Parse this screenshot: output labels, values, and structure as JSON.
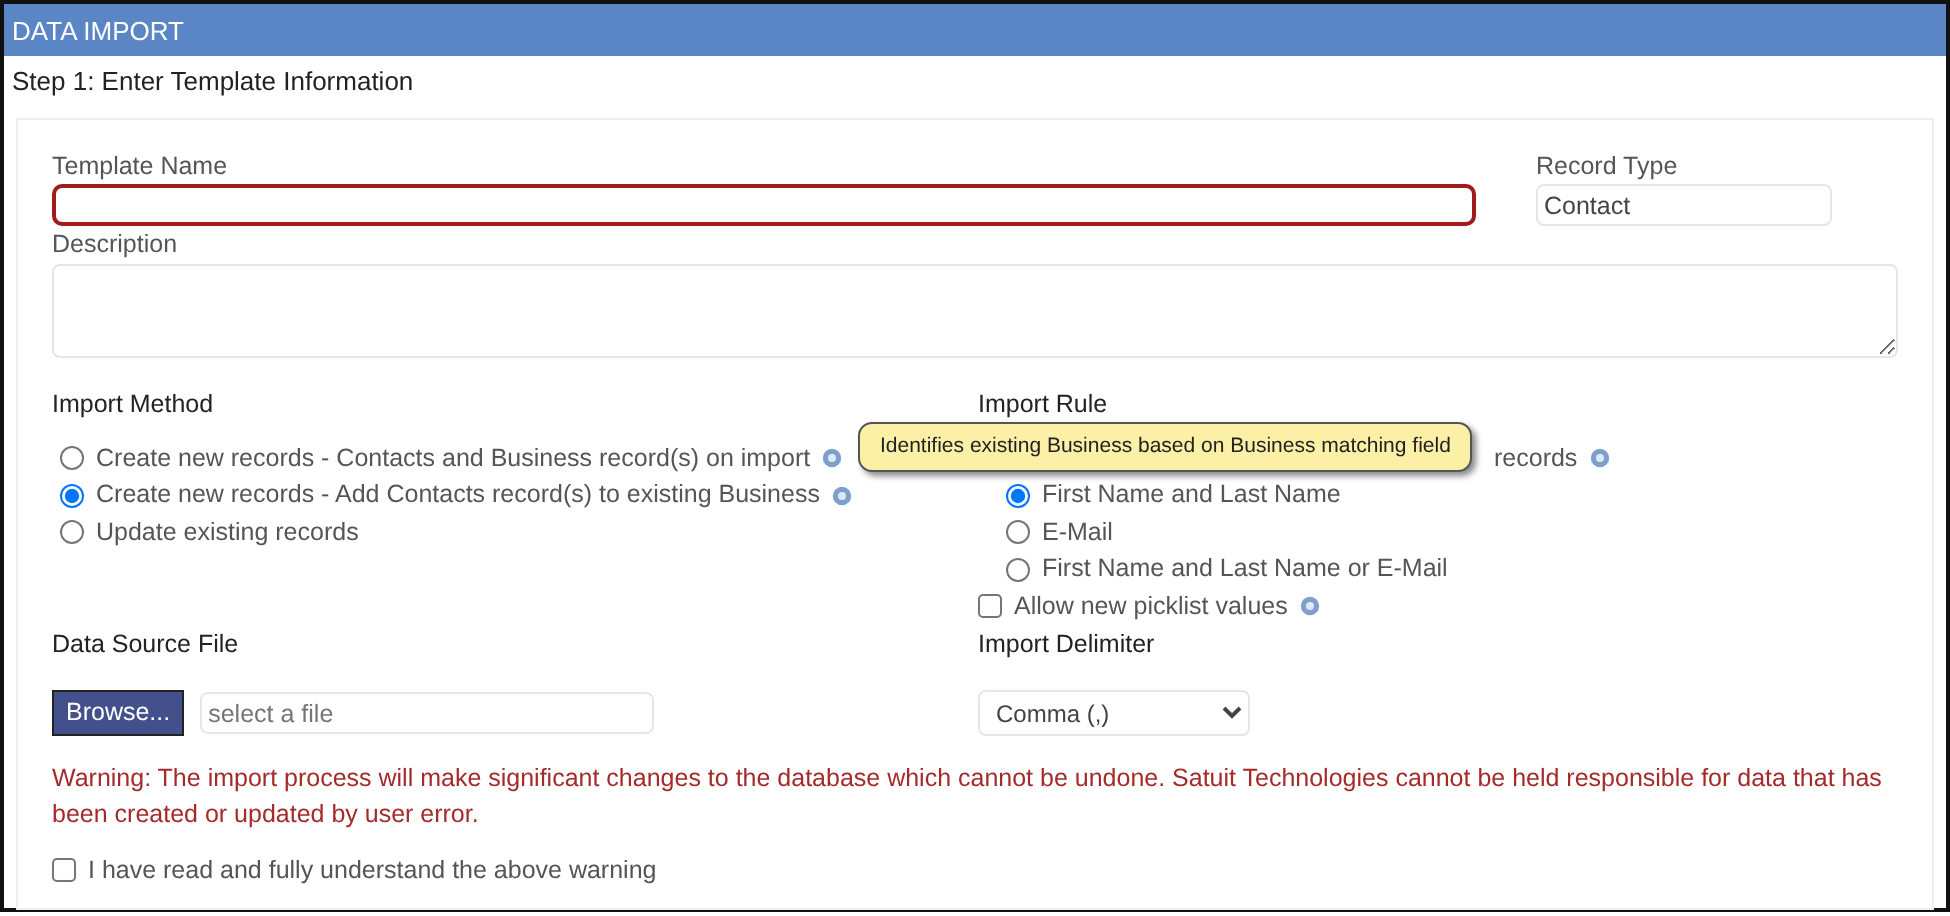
{
  "window": {
    "title": "DATA IMPORT"
  },
  "step": "Step 1: Enter Template Information",
  "template_name": {
    "label": "Template Name",
    "invalid": true
  },
  "record_type": {
    "label": "Record Type",
    "value": "Contact"
  },
  "description": {
    "label": "Description"
  },
  "import_method": {
    "label": "Import Method",
    "options": [
      {
        "label": "Create new records - Contacts and Business record(s) on import",
        "selected": false,
        "help": true
      },
      {
        "label": "Create new records - Add Contacts record(s) to existing Business",
        "selected": true,
        "help": true
      },
      {
        "label": "Update existing records",
        "selected": false,
        "help": false
      }
    ]
  },
  "import_rule": {
    "label": "Import Rule",
    "partial_option": "records",
    "options": [
      {
        "label": "First Name and Last Name",
        "selected": true
      },
      {
        "label": "E-Mail",
        "selected": false
      },
      {
        "label": "First Name and Last Name or E-Mail",
        "selected": false
      }
    ],
    "allow_picklist": {
      "label": "Allow new picklist values",
      "checked": false
    }
  },
  "tooltip": "Identifies existing Business based on Business matching field",
  "data_source": {
    "label": "Data Source File",
    "button": "Browse...",
    "placeholder": "select a file"
  },
  "delimiter": {
    "label": "Import Delimiter",
    "value": "Comma (,)"
  },
  "warning": "Warning: The import process will make significant changes to the database which cannot be undone. Satuit Technologies cannot be held responsible for data that has been created or updated by user error.",
  "acknowledge": {
    "label": "I have read and fully understand the above warning",
    "checked": false
  }
}
